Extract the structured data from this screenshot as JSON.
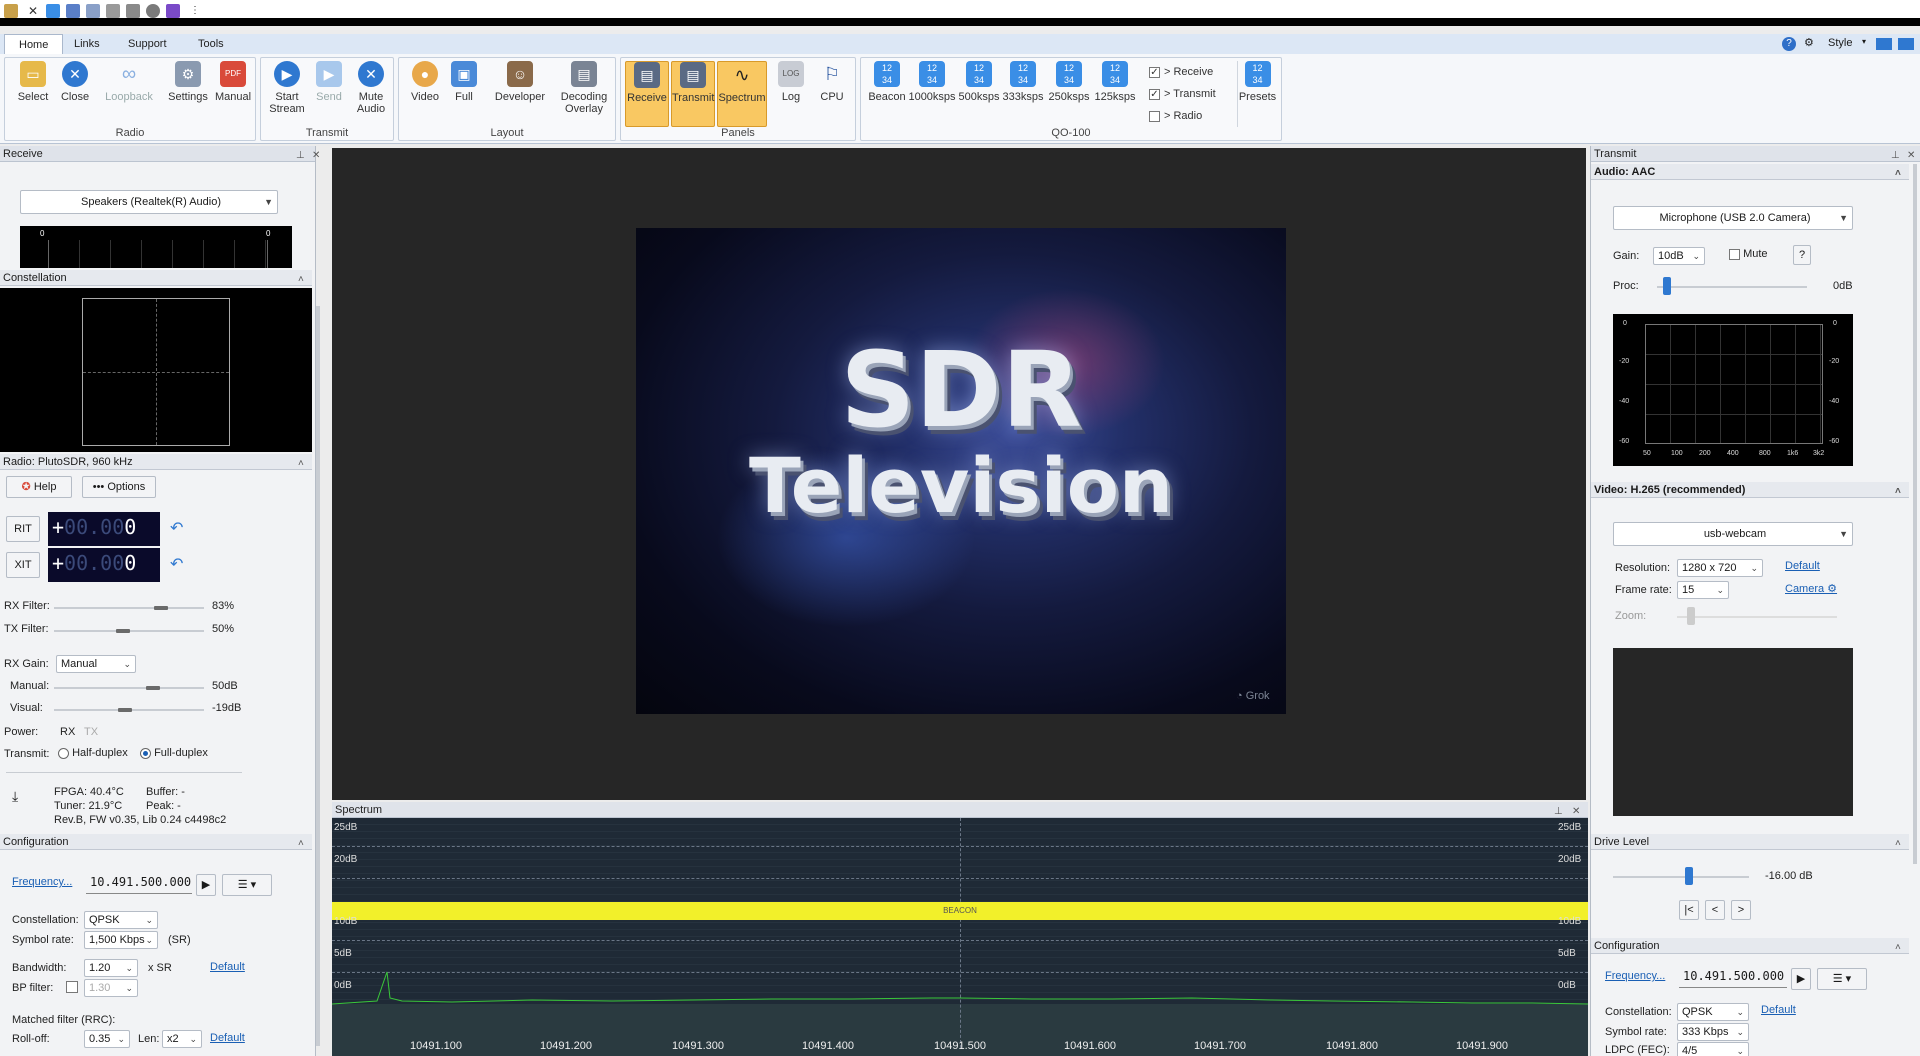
{
  "ribbon": {
    "tabs": [
      "Home",
      "Links",
      "Support",
      "Tools"
    ],
    "style_label": "Style",
    "groups": {
      "radio": {
        "label": "Radio",
        "buttons": [
          "Select",
          "Close",
          "Loopback",
          "Settings",
          "Manual"
        ]
      },
      "transmit": {
        "label": "Transmit",
        "buttons": [
          "Start\nStream",
          "Send",
          "Mute\nAudio"
        ]
      },
      "layout": {
        "label": "Layout",
        "buttons": [
          "Video",
          "Full",
          "Developer",
          "Decoding\nOverlay"
        ]
      },
      "panels": {
        "label": "Panels",
        "buttons": [
          "Receive",
          "Transmit",
          "Spectrum",
          "Log",
          "CPU"
        ]
      },
      "qo100": {
        "label": "QO-100",
        "buttons": [
          "Beacon",
          "1000ksps",
          "500ksps",
          "333ksps",
          "250ksps",
          "125ksps"
        ],
        "checks": [
          "> Receive",
          "> Transmit",
          "> Radio"
        ],
        "presets": "Presets"
      }
    }
  },
  "receive": {
    "title": "Receive",
    "audio_device": "Speakers (Realtek(R) Audio)",
    "meter_left": "0",
    "meter_right": "0",
    "constellation_title": "Constellation",
    "radio_title": "Radio: PlutoSDR, 960 kHz",
    "help": "Help",
    "options": "Options",
    "rit": "RIT",
    "xit": "XIT",
    "rit_value_dim": "00.00",
    "rit_value": "0",
    "xit_value_dim": "00.00",
    "xit_value": "0",
    "rx_filter_label": "RX Filter:",
    "rx_filter_value": "83%",
    "tx_filter_label": "TX Filter:",
    "tx_filter_value": "50%",
    "rx_gain_label": "RX Gain:",
    "rx_gain_mode": "Manual",
    "manual_label": "Manual:",
    "manual_value": "50dB",
    "visual_label": "Visual:",
    "visual_value": "-19dB",
    "power_label": "Power:",
    "power_rx": "RX",
    "power_tx": "TX",
    "transmit_label": "Transmit:",
    "half_duplex": "Half-duplex",
    "full_duplex": "Full-duplex",
    "fpga": "FPGA: 40.4°C",
    "buffer": "Buffer: -",
    "tuner": "Tuner: 21.9°C",
    "peak": "Peak: -",
    "rev": "Rev.B, FW v0.35, Lib 0.24 c4498c2",
    "config_title": "Configuration",
    "frequency_link": "Frequency...",
    "frequency": "10.491.500.000",
    "constellation_label": "Constellation:",
    "constellation_value": "QPSK",
    "symbol_rate_label": "Symbol rate:",
    "symbol_rate_value": "1,500 Kbps",
    "sr": "(SR)",
    "bandwidth_label": "Bandwidth:",
    "bandwidth_value": "1.20",
    "xsr": "x SR",
    "default": "Default",
    "bp_filter_label": "BP filter:",
    "bp_filter_value": "1.30",
    "matched_filter": "Matched filter (RRC):",
    "rolloff_label": "Roll-off:",
    "rolloff_value": "0.35",
    "len_label": "Len:",
    "len_value": "x2",
    "default2": "Default"
  },
  "video": {
    "line1": "SDR",
    "line2": "Television",
    "watermark": "Grok"
  },
  "spectrum": {
    "title": "Spectrum",
    "db_labels": [
      "25dB",
      "20dB",
      "10dB",
      "5dB",
      "0dB"
    ],
    "beacon": "BEACON",
    "freq_labels": [
      "10491.100",
      "10491.200",
      "10491.300",
      "10491.400",
      "10491.500",
      "10491.600",
      "10491.700",
      "10491.800",
      "10491.900"
    ]
  },
  "transmit": {
    "title": "Transmit",
    "audio_title": "Audio: AAC",
    "mic": "Microphone (USB 2.0 Camera)",
    "gain_label": "Gain:",
    "gain_value": "10dB",
    "mute": "Mute",
    "help_q": "?",
    "proc_label": "Proc:",
    "proc_value": "0dB",
    "eq_y": [
      "0",
      "-20",
      "-40",
      "-60"
    ],
    "eq_x": [
      "50",
      "100",
      "200",
      "400",
      "800",
      "1k6",
      "3k2"
    ],
    "video_title": "Video: H.265 (recommended)",
    "camera": "usb-webcam",
    "resolution_label": "Resolution:",
    "resolution_value": "1280 x 720",
    "default": "Default",
    "framerate_label": "Frame rate:",
    "framerate_value": "15",
    "camera_link": "Camera ⚙",
    "zoom_label": "Zoom:",
    "drive_title": "Drive Level",
    "drive_value": "-16.00 dB",
    "nav_first": "|<",
    "nav_prev": "<",
    "nav_next": ">",
    "config_title": "Configuration",
    "frequency_link": "Frequency...",
    "frequency": "10.491.500.000",
    "constellation_label": "Constellation:",
    "constellation_value": "QPSK",
    "default2": "Default",
    "symbol_rate_label": "Symbol rate:",
    "symbol_rate_value": "333 Kbps",
    "ldpc_label": "LDPC (FEC):",
    "ldpc_value": "4/5"
  }
}
